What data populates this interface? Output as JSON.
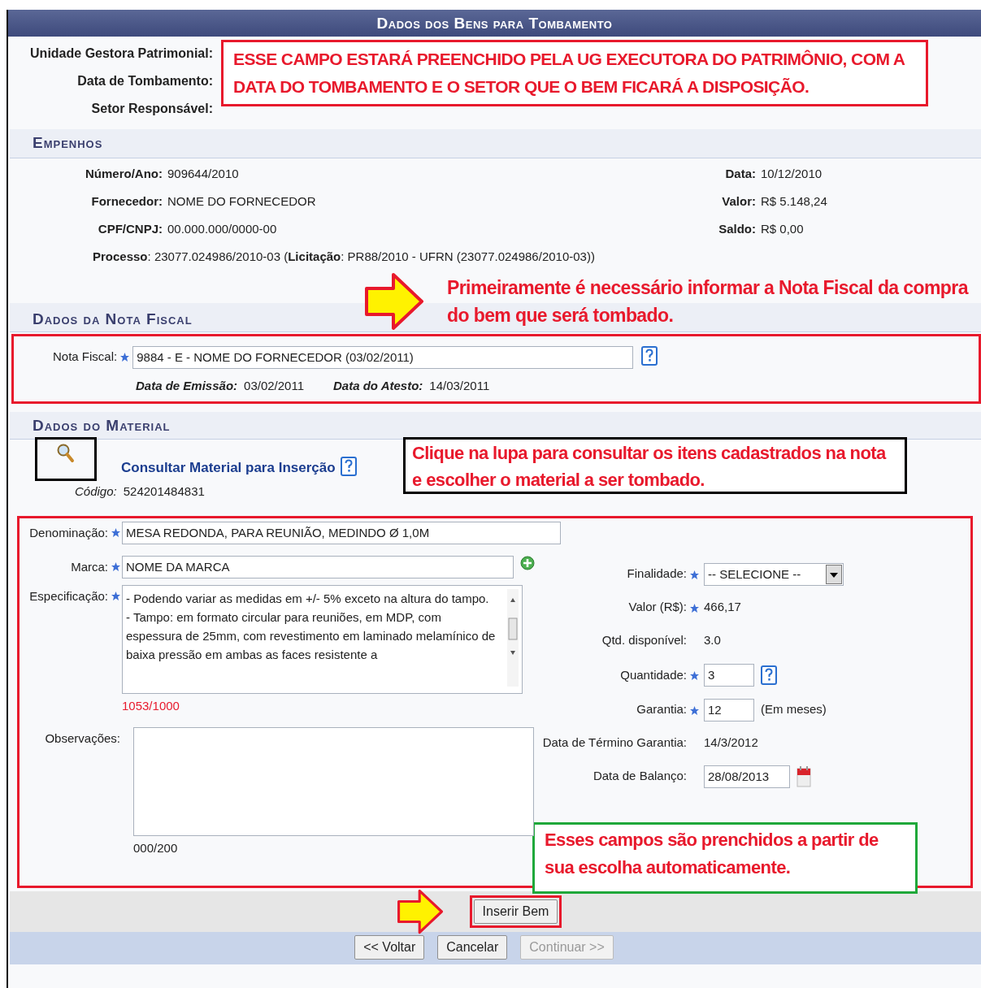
{
  "title": "Dados dos Bens para Tombamento",
  "header_labels": [
    "Unidade Gestora Patrimonial:",
    "Data de Tombamento:",
    "Setor Responsável:"
  ],
  "header_note": {
    "text": "ESSE CAMPO ESTARÁ PREENCHIDO PELA UG EXECUTORA DO PATRIMÔNIO, COM A DATA DO TOMBAMENTO E O SETOR QUE O BEM FICARÁ A DISPOSIÇÃO.",
    "color": "#e8192c"
  },
  "empenhos": {
    "heading": "Empenhos",
    "left": [
      {
        "label": "Número/Ano:",
        "value": "909644/2010"
      },
      {
        "label": "Fornecedor:",
        "value": "NOME DO FORNECEDOR"
      },
      {
        "label": "CPF/CNPJ:",
        "value": "00.000.000/0000-00"
      }
    ],
    "right": [
      {
        "label": "Data:",
        "value": "10/12/2010"
      },
      {
        "label": "Valor:",
        "value": "R$ 5.148,24"
      },
      {
        "label": "Saldo:",
        "value": "R$ 0,00"
      }
    ],
    "processo": "**Processo**: 23077.024986/2010-03 (**Licitação**: PR88/2010 - UFRN (23077.024986/2010-03))"
  },
  "nota_fiscal": {
    "heading": "Dados da Nota Fiscal",
    "note": {
      "text": "Primeiramente é necessário informar a Nota Fiscal da compra do bem que será tombado.",
      "color": "#e8192c"
    },
    "label": "Nota Fiscal:",
    "required": true,
    "value": "9884 - E - NOME DO FORNECEDOR (03/02/2011)",
    "dates": [
      {
        "label": "Data de Emissão:",
        "value": "03/02/2011"
      },
      {
        "label": "Data do Atesto:",
        "value": "14/03/2011"
      }
    ]
  },
  "material": {
    "heading": "Dados do Material",
    "link": "Consultar Material para Inserção",
    "codigo_label": "Código:",
    "codigo": "524201484831",
    "note": {
      "text": "Clique na lupa para consultar os itens cadastrados na nota e escolher o material a ser tombado.",
      "color": "#000000"
    },
    "left_fields": [
      {
        "kind": "input",
        "label": "Denominação:",
        "required": true,
        "value": "MESA REDONDA, PARA REUNIÃO, MEDINDO Ø 1,0M"
      },
      {
        "kind": "input_add",
        "label": "Marca:",
        "required": true,
        "value": "NOME DA MARCA"
      },
      {
        "kind": "textarea",
        "label": "Especificação:",
        "required": true,
        "value": "- Podendo variar as medidas em +/- 5% exceto na altura do tampo.\n- Tampo: em formato circular para reuniões, em MDP, com espessura de 25mm, com revestimento em laminado melamínico de baixa pressão em ambas as faces resistente a",
        "counter": "1053/1000",
        "over_limit": true
      },
      {
        "kind": "textarea",
        "label": "Observações:",
        "required": false,
        "counter": "000/200",
        "over_limit": false
      }
    ],
    "right_fields": [
      {
        "kind": "select",
        "label": "Finalidade:",
        "required": true,
        "value": "-- SELECIONE --"
      },
      {
        "kind": "text",
        "label": "Valor (R$):",
        "required": true,
        "value": "466,17"
      },
      {
        "kind": "text",
        "label": "Qtd. disponível:",
        "required": false,
        "value": "3.0"
      },
      {
        "kind": "input_help",
        "label": "Quantidade:",
        "required": true,
        "value": "3"
      },
      {
        "kind": "input_suffix",
        "label": "Garantia:",
        "required": true,
        "value": "12",
        "suffix": "(Em meses)"
      },
      {
        "kind": "text",
        "label": "Data de Término Garantia:",
        "required": false,
        "value": "14/3/2012"
      },
      {
        "kind": "date",
        "label": "Data de Balanço:",
        "required": false,
        "value": "28/08/2013"
      }
    ],
    "auto_note": {
      "text": "Esses campos são prenchidos a partir de sua escolha automaticamente.",
      "color": "#1fa83a"
    }
  },
  "insert_button": {
    "label": "Inserir Bem",
    "disabled": false
  },
  "nav_buttons": [
    {
      "label": "<< Voltar",
      "disabled": false
    },
    {
      "label": "Cancelar",
      "disabled": false
    },
    {
      "label": "Continuar >>",
      "disabled": true
    }
  ]
}
